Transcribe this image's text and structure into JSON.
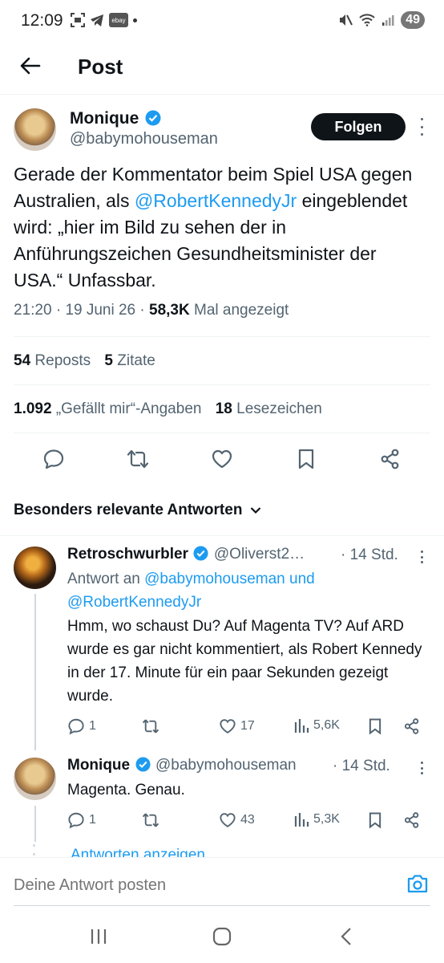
{
  "status_bar": {
    "time": "12:09",
    "battery": "49",
    "ebay": "ebay"
  },
  "header": {
    "title": "Post"
  },
  "post": {
    "author_name": "Monique",
    "handle": "@babymohouseman",
    "follow_label": "Folgen",
    "text_1": "Gerade der Kommentator beim Spiel USA gegen Australien, als ",
    "mention": "@RobertKennedyJr",
    "text_2": " eingeblendet wird: „hier im Bild zu sehen der in Anführungszeichen Gesundheitsminister der USA.“ Unfassbar.",
    "time": "21:20",
    "date": "19 Juni 26",
    "views": "58,3K",
    "views_label": "Mal angezeigt",
    "reposts_count": "54",
    "reposts_label": "Reposts",
    "quotes_count": "5",
    "quotes_label": "Zitate",
    "likes_count": "1.092",
    "likes_label": "„Gefällt mir“-Angaben",
    "bookmarks_count": "18",
    "bookmarks_label": "Lesezeichen"
  },
  "sort_label": "Besonders relevante Antworten",
  "replies": [
    {
      "name": "Retroschwurbler",
      "handle": "@Oliverst2…",
      "time": "· 14 Std.",
      "reply_to_label": "Antwort an",
      "reply_to_1": "@babymohouseman",
      "reply_to_and": "und",
      "reply_to_2": "@RobertKennedyJr",
      "body": "Hmm, wo schaust Du? Auf Magenta TV? Auf ARD wurde es gar nicht kommentiert, als Robert Kennedy in der 17. Minute für ein paar Sekunden gezeigt wurde.",
      "replies": "1",
      "likes": "17",
      "views": "5,6K"
    },
    {
      "name": "Monique",
      "handle": "@babymohouseman",
      "time": "· 14 Std.",
      "body": "Magenta. Genau.",
      "replies": "1",
      "likes": "43",
      "views": "5,3K"
    }
  ],
  "show_replies_label": "Antworten anzeigen",
  "reply_placeholder": "Deine Antwort posten"
}
